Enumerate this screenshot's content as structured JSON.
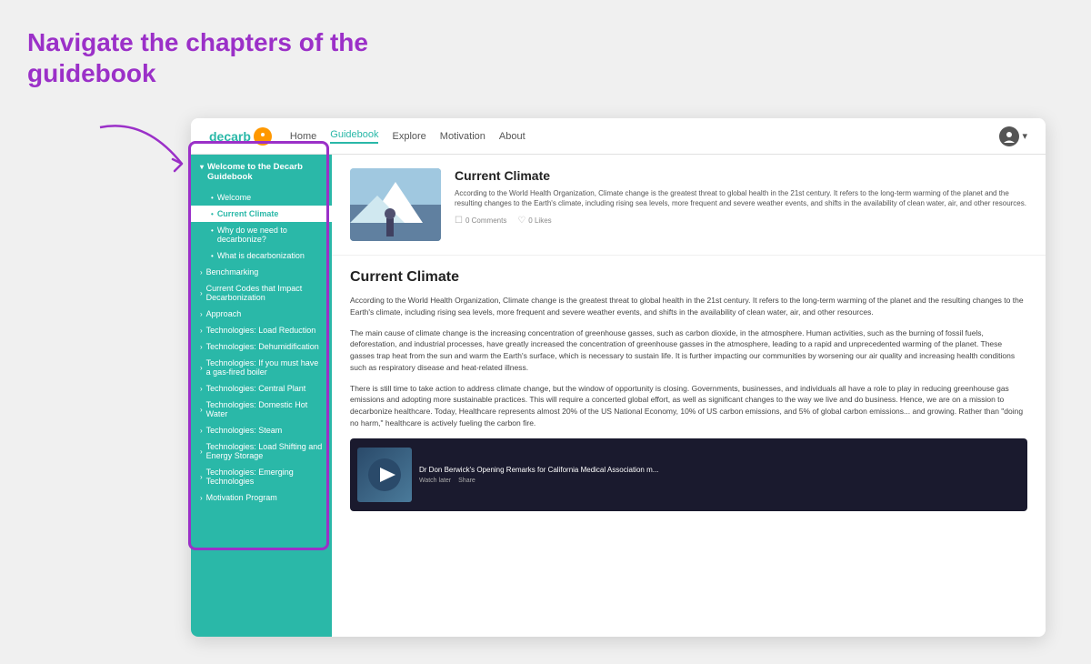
{
  "annotation": {
    "title": "Navigate the chapters of the\nguidebook"
  },
  "nav": {
    "logo": "decarb",
    "links": [
      "Home",
      "Guidebook",
      "Explore",
      "Motivation",
      "About"
    ],
    "active_link": "Guidebook"
  },
  "sidebar": {
    "header": "Welcome to the Decarb Guidebook",
    "items": [
      {
        "label": "Welcome",
        "type": "bullet",
        "active": false
      },
      {
        "label": "Current Climate",
        "type": "bullet",
        "active": true
      },
      {
        "label": "Why do we need to decarbonize?",
        "type": "bullet",
        "active": false
      },
      {
        "label": "What is decarbonization",
        "type": "bullet",
        "active": false
      },
      {
        "label": "Benchmarking",
        "type": "section",
        "active": false
      },
      {
        "label": "Current Codes that Impact Decarbonization",
        "type": "section",
        "active": false
      },
      {
        "label": "Approach",
        "type": "section",
        "active": false
      },
      {
        "label": "Technologies: Load Reduction",
        "type": "section",
        "active": false
      },
      {
        "label": "Technologies: Dehumidification",
        "type": "section",
        "active": false
      },
      {
        "label": "Technologies: If you must have a gas-fired boiler",
        "type": "section",
        "active": false
      },
      {
        "label": "Technologies: Central Plant",
        "type": "section",
        "active": false
      },
      {
        "label": "Technologies: Domestic Hot Water",
        "type": "section",
        "active": false
      },
      {
        "label": "Technologies: Steam",
        "type": "section",
        "active": false
      },
      {
        "label": "Technologies: Load Shifting and Energy Storage",
        "type": "section",
        "active": false
      },
      {
        "label": "Technologies: Emerging Technologies",
        "type": "section",
        "active": false
      },
      {
        "label": "Motivation Program",
        "type": "section",
        "active": false
      }
    ]
  },
  "hero": {
    "title": "Current Climate",
    "description": "According to the World Health Organization, Climate change is the greatest threat to global health in the 21st century. It refers to the long-term warming of the planet and the resulting changes to the Earth's climate, including rising sea levels, more frequent and severe weather events, and shifts in the availability of clean water, air, and other resources.",
    "comments": "0 Comments",
    "likes": "0 Likes"
  },
  "article": {
    "title": "Current Climate",
    "paragraphs": [
      "According to the World Health Organization, Climate change is the greatest threat to global health in the 21st century. It refers to the long-term warming of the planet and the resulting changes to the Earth's climate, including rising sea levels, more frequent and severe weather events, and shifts in the availability of clean water, air, and other resources.",
      "The main cause of climate change is the increasing concentration of greenhouse gasses, such as carbon dioxide, in the atmosphere. Human activities, such as the burning of fossil fuels, deforestation, and industrial processes, have greatly increased the concentration of greenhouse gasses in the atmosphere, leading to a rapid and unprecedented warming of the planet. These gasses trap heat from the sun and warm the Earth's surface, which is necessary to sustain life. It is further impacting our communities by worsening our air quality and increasing health conditions such as respiratory disease and heat-related illness.",
      "There is still time to take action to address climate change, but the window of opportunity is closing. Governments, businesses, and individuals all have a role to play in reducing greenhouse gas emissions and adopting more sustainable practices. This will require a concerted global effort, as well as significant changes to the way we live and do business. Hence, we are on a mission to decarbonize healthcare. Today, Healthcare represents almost 20% of the US National Economy, 10% of US carbon emissions, and 5% of global carbon emissions... and growing. Rather than \"doing no harm,\" healthcare is actively fueling the carbon fire."
    ]
  },
  "video": {
    "title": "Dr Don Berwick's Opening Remarks for California Medical Association m...",
    "watch_later": "Watch later",
    "share": "Share"
  }
}
